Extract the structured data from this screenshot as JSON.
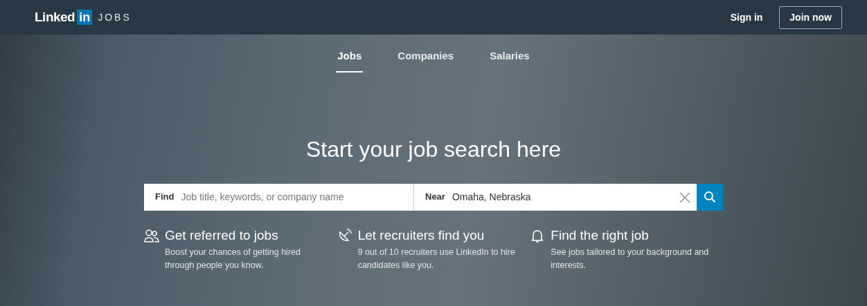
{
  "header": {
    "logo": {
      "word": "Linked",
      "badge": "in",
      "product": "JOBS"
    },
    "sign_in": "Sign in",
    "join_now": "Join now"
  },
  "tabs": [
    {
      "label": "Jobs",
      "selected": true
    },
    {
      "label": "Companies",
      "selected": false
    },
    {
      "label": "Salaries",
      "selected": false
    }
  ],
  "headline": "Start your job search here",
  "search": {
    "find_label": "Find",
    "find_placeholder": "Job title, keywords, or company name",
    "near_label": "Near",
    "near_value": "Omaha, Nebraska"
  },
  "features": [
    {
      "kind": "people",
      "title": "Get referred to jobs",
      "text": "Boost your chances of getting hired through people you know."
    },
    {
      "kind": "radar",
      "title": "Let recruiters find you",
      "text": "9 out of 10 recruiters use LinkedIn to hire candidates like you."
    },
    {
      "kind": "bell",
      "title": "Find the right job",
      "text": "See jobs tailored to your background and interests."
    }
  ]
}
